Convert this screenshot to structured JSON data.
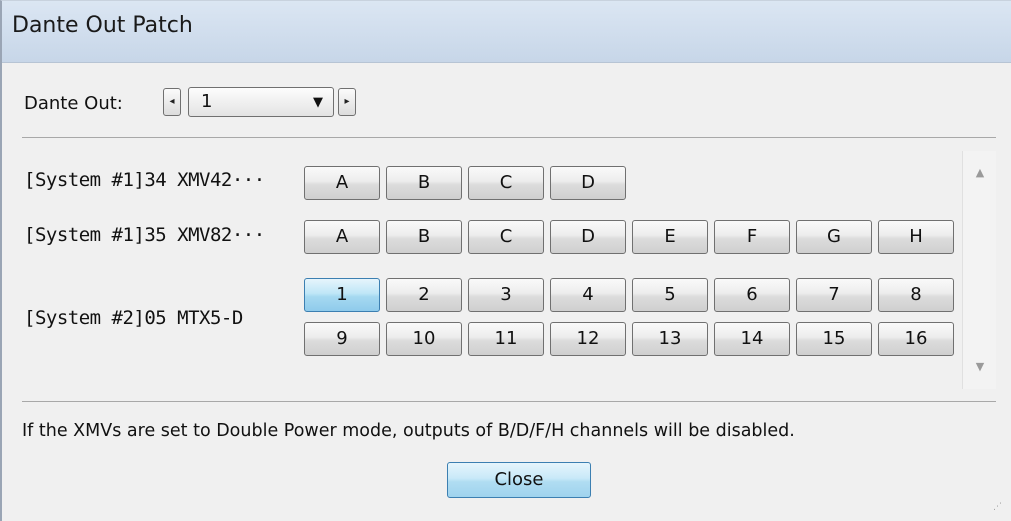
{
  "window": {
    "title": "Dante Out Patch"
  },
  "dante_out": {
    "label": "Dante Out:",
    "prev_arrow": "◂",
    "next_arrow": "▸",
    "selected_value": "1",
    "caret": "▼"
  },
  "devices": [
    {
      "name": "[System #1]34 XMV42···",
      "buttons": [
        "A",
        "B",
        "C",
        "D"
      ]
    },
    {
      "name": "[System #1]35 XMV82···",
      "buttons": [
        "A",
        "B",
        "C",
        "D",
        "E",
        "F",
        "G",
        "H"
      ]
    },
    {
      "name": "[System #2]05 MTX5-D",
      "buttons_row1": [
        "1",
        "2",
        "3",
        "4",
        "5",
        "6",
        "7",
        "8"
      ],
      "buttons_row2": [
        "9",
        "10",
        "11",
        "12",
        "13",
        "14",
        "15",
        "16"
      ],
      "selected": "1"
    }
  ],
  "scrollbar": {
    "up": "▲",
    "down": "▼"
  },
  "notice": "If the XMVs are set to Double Power mode, outputs of  B/D/F/H channels will be disabled.",
  "close_label": "Close",
  "colors": {
    "selected": "#a6d9f1",
    "title_bar": "#c7d6e8"
  }
}
